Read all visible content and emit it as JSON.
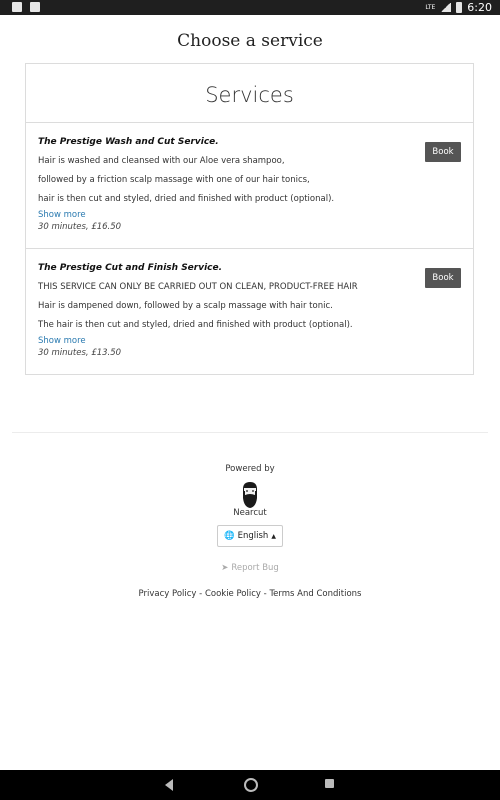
{
  "status_bar": {
    "time": "6:20",
    "network": "LTE"
  },
  "page_title": "Choose a service",
  "card_title": "Services",
  "services": [
    {
      "name": "The Prestige Wash and Cut Service.",
      "lines": [
        "Hair is washed and cleansed with our Aloe vera shampoo,",
        "followed by a friction scalp massage with one of our hair tonics,",
        "hair is then cut and styled, dried and finished with product (optional)."
      ],
      "show_more": "Show more",
      "meta": "30 minutes, £16.50",
      "book_label": "Book"
    },
    {
      "name": "The Prestige Cut and Finish Service.",
      "lines": [
        "THIS SERVICE CAN ONLY BE CARRIED OUT ON CLEAN, PRODUCT-FREE HAIR",
        "Hair is dampened down, followed by a scalp massage with hair tonic.",
        "The hair is then cut and styled, dried and finished with product (optional)."
      ],
      "show_more": "Show more",
      "meta": "30 minutes, £13.50",
      "book_label": "Book"
    }
  ],
  "footer": {
    "powered_by": "Powered by",
    "brand": "Nearcut",
    "language": "English",
    "report_bug": "Report Bug",
    "links": {
      "privacy": "Privacy Policy",
      "cookie": "Cookie Policy",
      "terms": "Terms And Conditions",
      "separator": " - "
    }
  },
  "colors": {
    "button_bg": "#555555",
    "link": "#2a7ab0",
    "muted": "#aaaaaa",
    "status_bar": "#1f1f1f",
    "nav_bar": "#000000"
  }
}
